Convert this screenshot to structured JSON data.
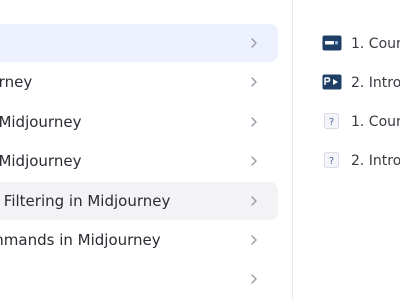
{
  "modules": [
    {
      "label": "",
      "state": "active"
    },
    {
      "label": "ourney",
      "state": "normal"
    },
    {
      "label": "in Midjourney",
      "state": "normal"
    },
    {
      "label": "in Midjourney",
      "state": "normal"
    },
    {
      "label": "nd Filtering in Midjourney",
      "state": "hover"
    },
    {
      "label": "ommands in Midjourney",
      "state": "normal"
    },
    {
      "label": "",
      "state": "normal"
    }
  ],
  "lessons": [
    {
      "label": "1. Cour",
      "icon": "slides-icon"
    },
    {
      "label": "2. Intro",
      "icon": "video-icon"
    },
    {
      "label": "1. Cour",
      "icon": "quiz-icon"
    },
    {
      "label": "2. Intro",
      "icon": "quiz-icon"
    }
  ],
  "colors": {
    "active_bg": "#edf0fd",
    "hover_bg": "#f3f3f5",
    "icon_dark": "#1f3f66",
    "chevron": "#9a9aa6"
  }
}
